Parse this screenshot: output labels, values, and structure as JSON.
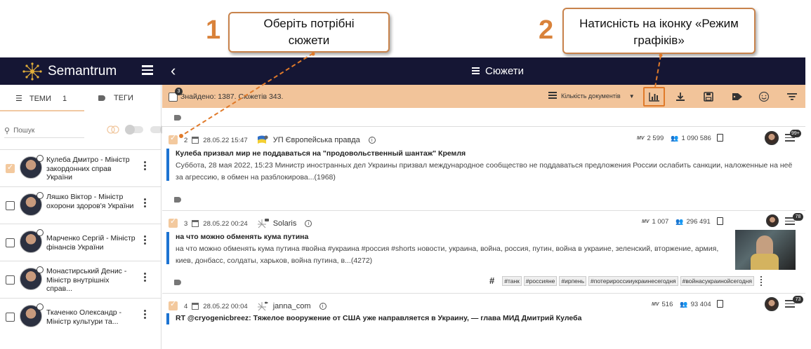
{
  "callouts": [
    {
      "number": "1",
      "text": "Оберіть потрібні сюжети"
    },
    {
      "number": "2",
      "text": "Натисність на іконку «Режим графіків»"
    }
  ],
  "app": {
    "name": "Semantrum",
    "page_title": "Сюжети"
  },
  "sidebar": {
    "tabs": [
      {
        "label": "ТЕМИ",
        "count": "1"
      },
      {
        "label": "ТЕГИ"
      }
    ],
    "search_placeholder": "Пошук",
    "items": [
      {
        "name": "Кулеба Дмитро - Міністр закордонних справ України",
        "checked": true
      },
      {
        "name": "Ляшко Віктор - Міністр охорони здоров'я України",
        "checked": false
      },
      {
        "name": "Марченко Сергій - Міністр фінансів України",
        "checked": false
      },
      {
        "name": "Монастирський Денис - Міністр внутрішніх справ...",
        "checked": false
      },
      {
        "name": "Ткаченко Олександр - Міністр культури та...",
        "checked": false
      }
    ]
  },
  "toolbar": {
    "selected_count": "3",
    "found_text": "Знайдено: 1387. Сюжетів 343.",
    "sort_label": "Кількість документів"
  },
  "cards": [
    {
      "index": "2",
      "date": "28.05.22 15:47",
      "source": "УП Європейська правда",
      "views_label": "MV",
      "views": "2 599",
      "audience": "1 090 586",
      "comments": "99+",
      "title": "Кулеба призвал мир не поддаваться на \"продовольственный шантаж\" Кремля",
      "text": "Суббота, 28 мая 2022, 15:23 Министр иностранных дел Украины призвал международное сообщество не поддаваться предложения России ослабить санкции, наложенные на неё за агрессию, в обмен на разблокирова...(1968)"
    },
    {
      "index": "3",
      "date": "28.05.22 00:24",
      "source": "Solaris",
      "views_label": "MV",
      "views": "1 007",
      "audience": "296 491",
      "comments": "78",
      "title": "на что можно обменять кума путина",
      "text": "на что можно обменять кума путина #война #украина #россия #shorts новости, украина, война, россия, путин, война в украине, зеленский, вторжение, армия, киев, донбасс, солдаты, харьков, война путина, в...(4272)",
      "hashtags": [
        "#танк",
        "#россияне",
        "#ирпень",
        "#потерироссииукраинесегодня",
        "#войнасукраинойсегодня"
      ]
    },
    {
      "index": "4",
      "date": "28.05.22 00:04",
      "source": "janna_com",
      "views_label": "MV",
      "views": "516",
      "audience": "93 404",
      "comments": "73",
      "title": "RT @cryogenicbreez: Тяжелое вооружение от США уже направляется в Украину, — глава МИД Дмитрий Кулеба",
      "text": ""
    }
  ],
  "colors": {
    "topbar": "#151634",
    "toolbar": "#f2c49a",
    "accent": "#d9823a",
    "card_border": "#1d74d2"
  }
}
